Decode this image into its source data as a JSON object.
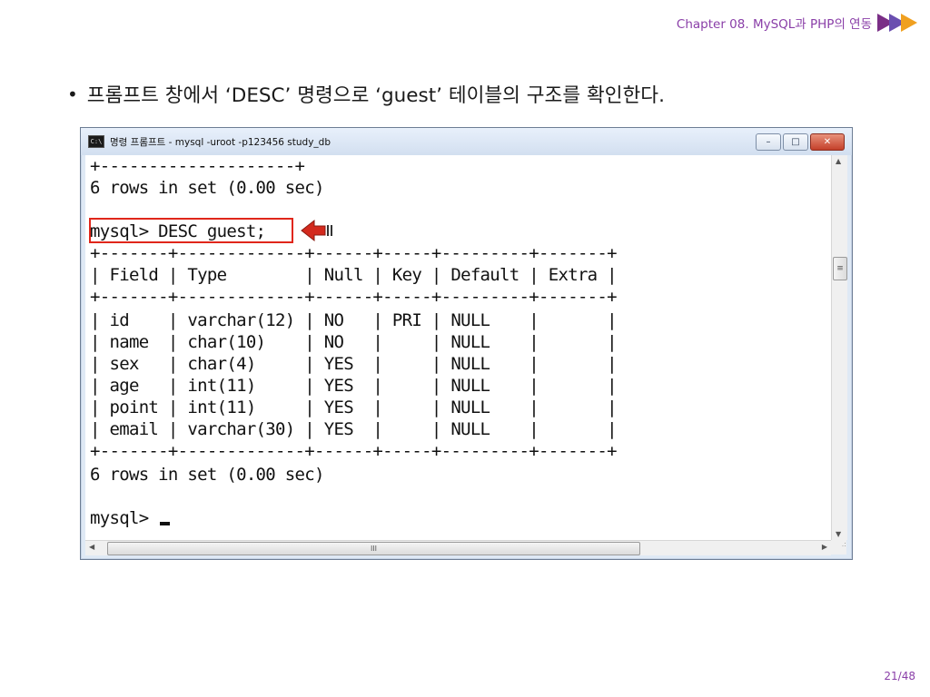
{
  "header": {
    "chapter_title": "Chapter 08. MySQL과 PHP의 연동",
    "chevron_colors": [
      "#7a2e86",
      "#6a4fb0",
      "#f0a020"
    ]
  },
  "slide": {
    "bullet": "•",
    "bullet_text": "프롬프트 창에서 ‘DESC’ 명령으로 ‘guest’ 테이블의 구조를 확인한다."
  },
  "console_window": {
    "icon_text": "C:\\",
    "title": "명령 프롬프트 - mysql  -uroot -p123456 study_db",
    "controls": {
      "minimize": "–",
      "maximize": "□",
      "close": "✕"
    },
    "lines": [
      "+--------------------+",
      "6 rows in set (0.00 sec)",
      "",
      "mysql> DESC guest;",
      "+-------+-------------+------+-----+---------+-------+",
      "| Field | Type        | Null | Key | Default | Extra |",
      "+-------+-------------+------+-----+---------+-------+",
      "| id    | varchar(12) | NO   | PRI | NULL    |       |",
      "| name  | char(10)    | NO   |     | NULL    |       |",
      "| sex   | char(4)     | YES  |     | NULL    |       |",
      "| age   | int(11)     | YES  |     | NULL    |       |",
      "| point | int(11)     | YES  |     | NULL    |       |",
      "| email | varchar(30) | YES  |     | NULL    |       |",
      "+-------+-------------+------+-----+---------+-------+",
      "6 rows in set (0.00 sec)",
      "",
      "mysql> "
    ],
    "scroll_glyphs": {
      "up": "▲",
      "down": "▼",
      "left": "◀",
      "right": "▶",
      "thumb_v": "≡",
      "thumb_h": "III",
      "grip": ".:"
    }
  },
  "colors": {
    "highlight": "#e0261a",
    "accent_text": "#8a3fa8"
  },
  "footer": {
    "page_number": "21/48"
  }
}
